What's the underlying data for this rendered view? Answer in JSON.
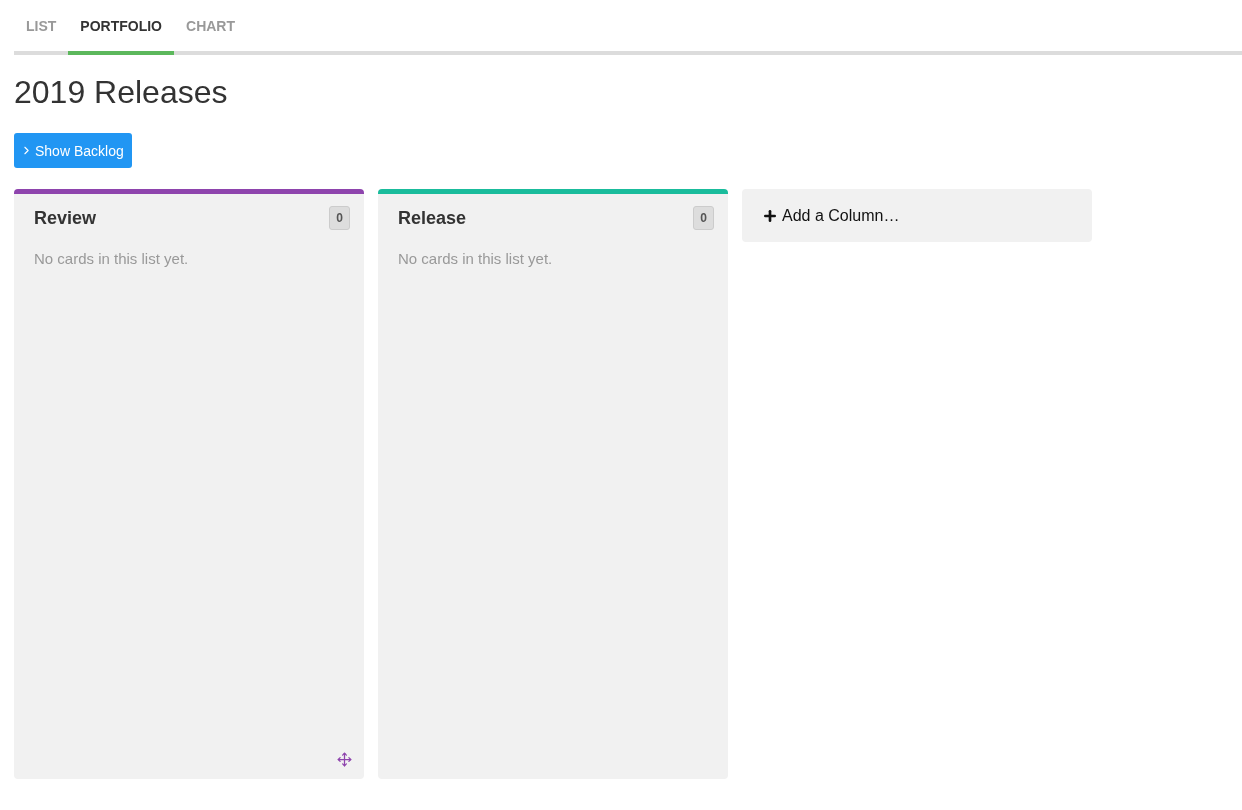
{
  "tabs": [
    {
      "label": "LIST",
      "selected": false
    },
    {
      "label": "PORTFOLIO",
      "selected": true
    },
    {
      "label": "CHART",
      "selected": false
    }
  ],
  "title": "2019 Releases",
  "backlog_button": {
    "label": "Show Backlog"
  },
  "columns": [
    {
      "name": "Review",
      "count": "0",
      "empty_text": "No cards in this list yet.",
      "color": "#8e44ad",
      "move_handle": true
    },
    {
      "name": "Release",
      "count": "0",
      "empty_text": "No cards in this list yet.",
      "color": "#1abc9c",
      "move_handle": false
    }
  ],
  "add_column": {
    "label": "Add a Column…"
  }
}
